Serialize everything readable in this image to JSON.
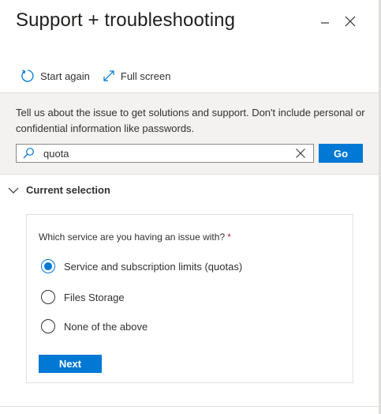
{
  "header": {
    "title": "Support + troubleshooting",
    "minimize_glyph": "—",
    "close_glyph": "✕"
  },
  "toolbar": {
    "start_again_label": "Start again",
    "start_again_icon": "refresh-icon",
    "full_screen_label": "Full screen",
    "full_screen_icon": "expand-icon"
  },
  "info": {
    "text": "Tell us about the issue to get solutions and support. Don't include personal or confidential information like passwords."
  },
  "search": {
    "value": "quota",
    "placeholder": "",
    "go_label": "Go"
  },
  "section": {
    "title": "Current selection",
    "expanded": true
  },
  "form": {
    "question": "Which service are you having an issue with?",
    "required_mark": "*",
    "options": [
      {
        "label": "Service and subscription limits (quotas)",
        "selected": true
      },
      {
        "label": "Files Storage",
        "selected": false
      },
      {
        "label": "None of the above",
        "selected": false
      }
    ],
    "next_label": "Next"
  },
  "colors": {
    "accent": "#0078d4",
    "required": "#a4262c",
    "info_background": "#f3f2f1"
  }
}
